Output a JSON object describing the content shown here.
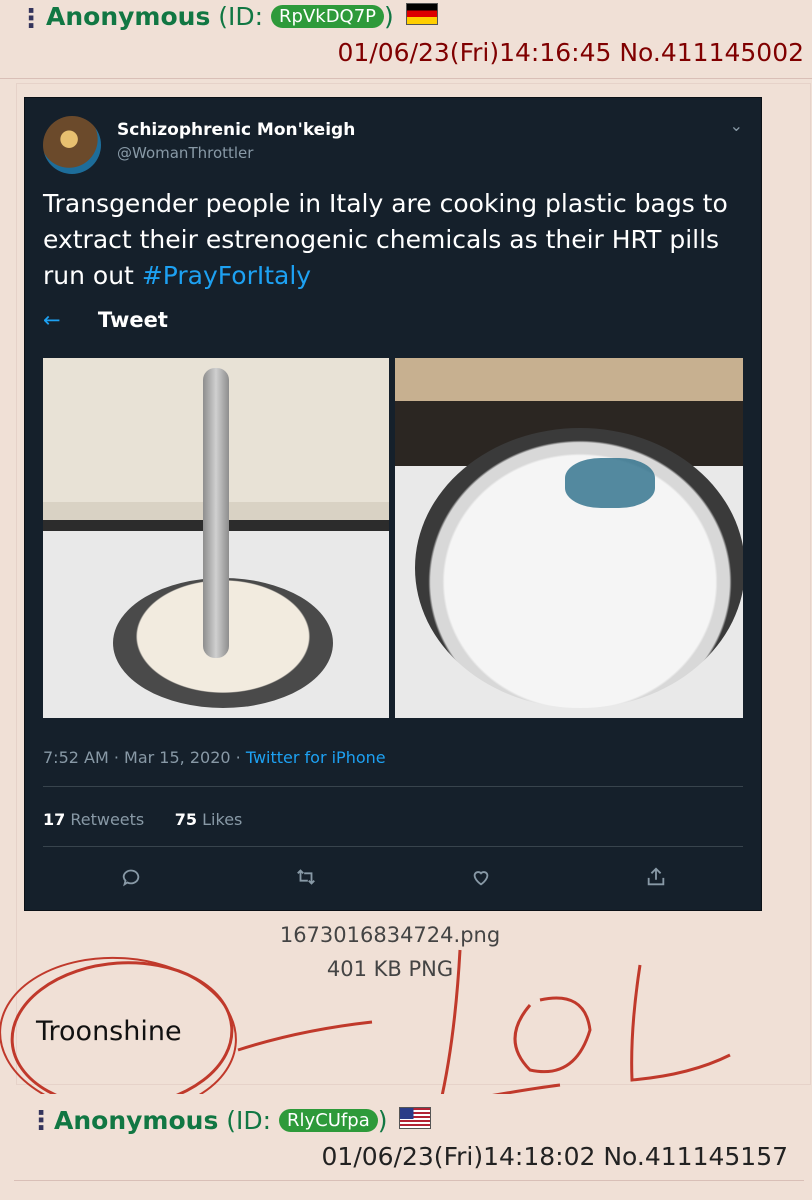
{
  "post1": {
    "menu": "⋮",
    "name": "Anonymous",
    "id_prefix": "(ID: ",
    "id": "RpVkDQ7P",
    "id_color": "#2e9a3a",
    "id_suffix": ")",
    "flag": "de-flag",
    "datetime": "01/06/23(Fri)14:16:45",
    "post_no": "No.411145002",
    "file_name": "1673016834724.png",
    "file_info": "401 KB PNG",
    "comment": "Troonshine"
  },
  "tweet": {
    "display_name": "Schizophrenic Mon'keigh",
    "handle": "@WomanThrottler",
    "text": "Transgender people in Italy are cooking plastic bags to extract their estrenogenic chemicals as their HRT pills run out ",
    "hashtag": "#PrayForItaly",
    "nav_title": "Tweet",
    "back_icon": "←",
    "timestamp": "7:52 AM · Mar 15, 2020 · ",
    "source": "Twitter for iPhone",
    "retweets": "17",
    "retweets_label": "Retweets",
    "likes": "75",
    "likes_label": "Likes",
    "actions": [
      "reply-icon",
      "retweet-icon",
      "like-icon",
      "share-icon"
    ],
    "colors": {
      "background": "#15202b",
      "accent": "#1da1f2",
      "muted": "#8899a6"
    }
  },
  "scribble": {
    "text": "LOL",
    "color": "#c0392b"
  },
  "post2": {
    "menu": "⋮",
    "name": "Anonymous",
    "id_prefix": "(ID: ",
    "id": "RlyCUfpa",
    "id_color": "#2e9a3a",
    "id_suffix": ")",
    "flag": "us-flag",
    "datetime": "01/06/23(Fri)14:18:02",
    "post_no": "No.411145157"
  }
}
